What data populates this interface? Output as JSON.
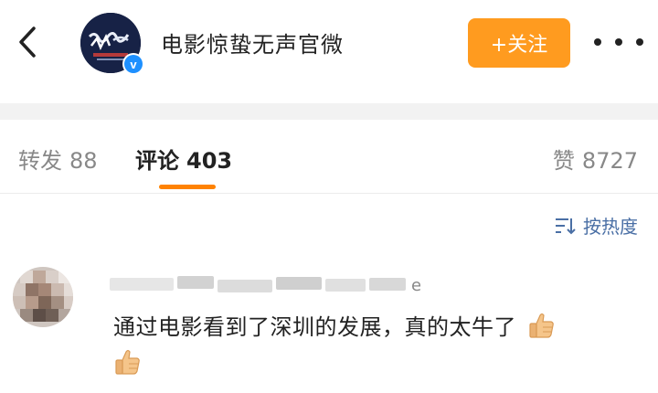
{
  "header": {
    "back_icon": "chevron-left-icon",
    "account_name": "电影惊蛰无声官微",
    "verified_badge": "v",
    "follow_label": "+关注",
    "more_icon": "more-dots-icon",
    "follow_color": "#ff9b1f"
  },
  "tabs": {
    "repost": {
      "label": "转发",
      "count": "88"
    },
    "comment": {
      "label": "评论",
      "count": "403"
    },
    "like": {
      "label": "赞",
      "count": "8727"
    },
    "active": "comment",
    "accent_color": "#ff8200"
  },
  "sort": {
    "label": "按热度",
    "icon": "sort-icon"
  },
  "comments": [
    {
      "username_tail": "e",
      "text": "通过电影看到了深圳的发展，真的太牛了",
      "emoji": [
        "thumbs-up-icon",
        "thumbs-up-icon"
      ]
    }
  ]
}
